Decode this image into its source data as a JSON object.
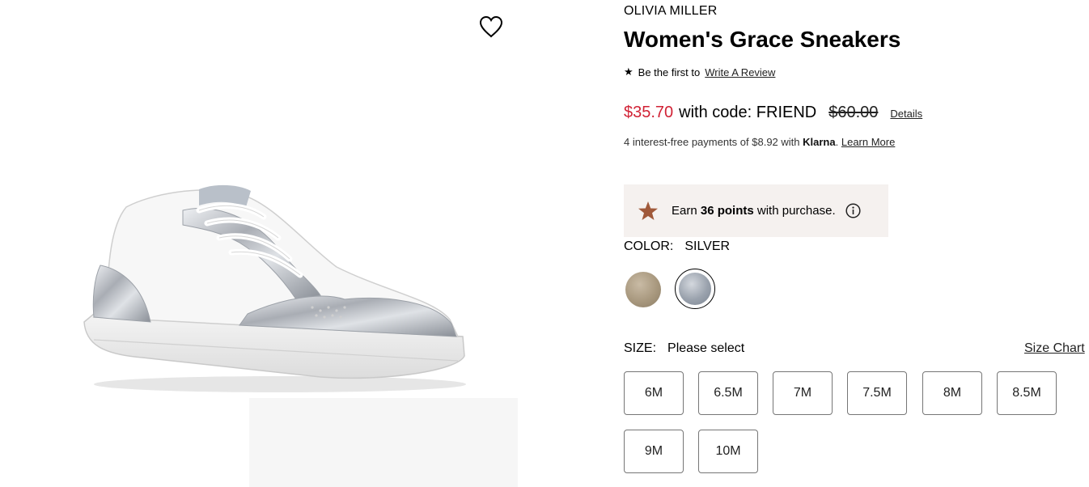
{
  "product": {
    "brand": "OLIVIA MILLER",
    "title": "Women's Grace Sneakers"
  },
  "review": {
    "prefix": "Be the first to",
    "link": "Write A Review"
  },
  "price": {
    "sale": "$35.70",
    "code_text": "with code: FRIEND",
    "original": "$60.00",
    "details_link": "Details",
    "sale_color": "#d12235"
  },
  "klarna": {
    "prefix": "4 interest-free payments of $8.92 with",
    "brand": "Klarna",
    "period": ".",
    "link": "Learn More"
  },
  "rewards": {
    "prefix": "Earn",
    "points": "36 points",
    "suffix": "with purchase.",
    "star_color": "#a0593a",
    "bg_color": "#f5f1ef"
  },
  "color": {
    "label": "COLOR:",
    "selected": "SILVER",
    "swatches": [
      {
        "name": "gold",
        "selected": false
      },
      {
        "name": "silver",
        "selected": true
      }
    ]
  },
  "size": {
    "label": "SIZE:",
    "value": "Please select",
    "chart_link": "Size Chart",
    "options": [
      "6M",
      "6.5M",
      "7M",
      "7.5M",
      "8M",
      "8.5M",
      "9M",
      "10M"
    ]
  },
  "icons": {
    "wishlist": "heart-icon",
    "review_star": "star-icon",
    "points_star": "star-icon",
    "info": "info-icon"
  }
}
